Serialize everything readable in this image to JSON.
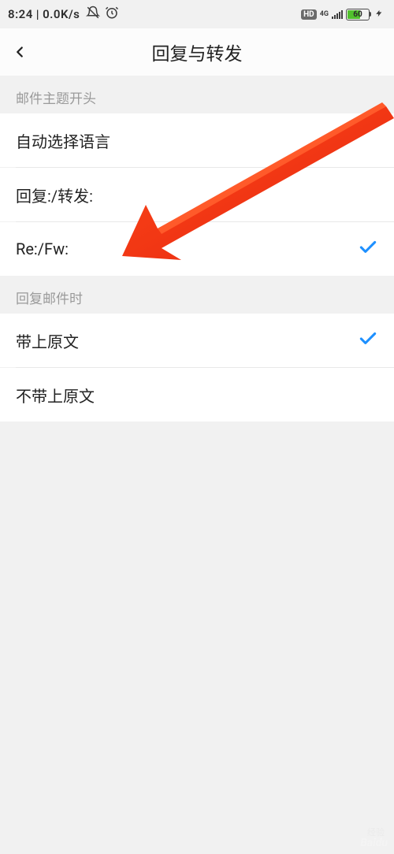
{
  "status": {
    "time": "8:24",
    "net_speed": "0.0K/s",
    "hd_label": "HD",
    "net_type": "4G",
    "battery_pct": "60"
  },
  "header": {
    "title": "回复与转发"
  },
  "sections": {
    "subject_prefix": {
      "header": "邮件主题开头",
      "items": [
        {
          "label": "自动选择语言",
          "selected": false
        },
        {
          "label": "回复:/转发:",
          "selected": false
        },
        {
          "label": "Re:/Fw:",
          "selected": true
        }
      ]
    },
    "on_reply": {
      "header": "回复邮件时",
      "items": [
        {
          "label": "带上原文",
          "selected": true
        },
        {
          "label": "不带上原文",
          "selected": false
        }
      ]
    }
  },
  "watermark": {
    "brand": "Baidu",
    "sub": "经验"
  }
}
